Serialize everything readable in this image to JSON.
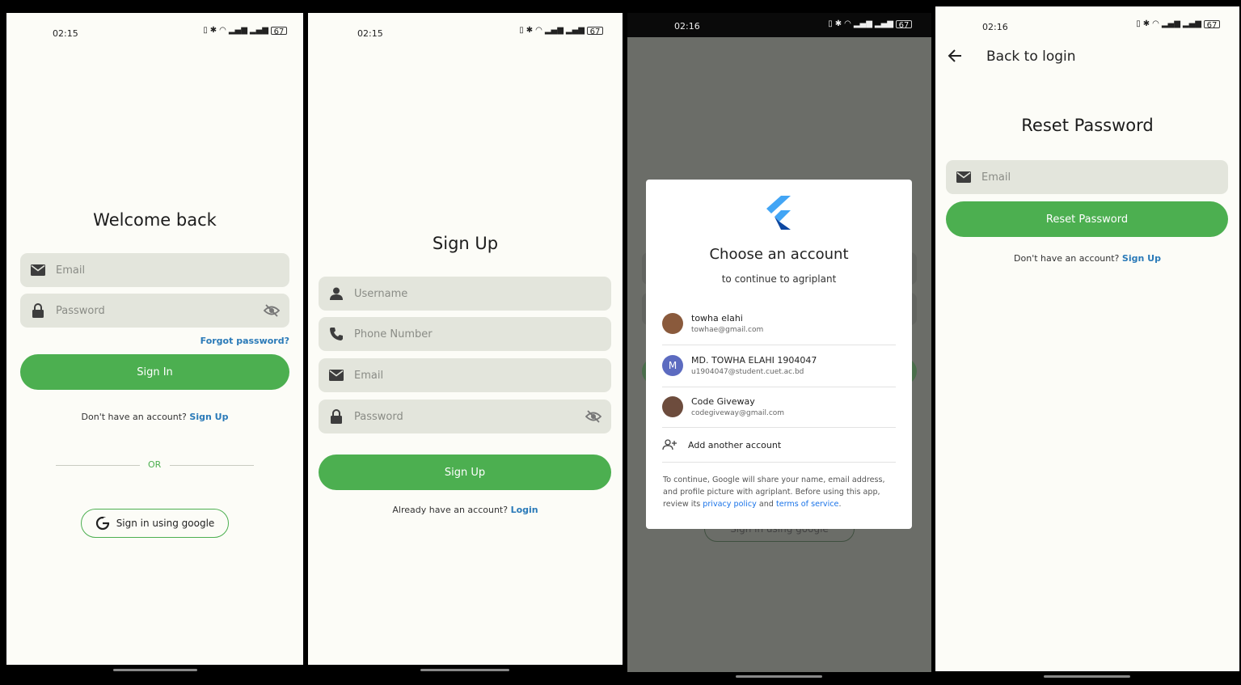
{
  "screens": {
    "login": {
      "time": "02:15",
      "battery": "67",
      "title": "Welcome back",
      "email_placeholder": "Email",
      "password_placeholder": "Password",
      "forgot": "Forgot password?",
      "signin_button": "Sign In",
      "no_account": "Don't have an account?",
      "signup_link": "Sign Up",
      "or": "OR",
      "google_button": "Sign in using google"
    },
    "signup": {
      "time": "02:15",
      "battery": "67",
      "title": "Sign Up",
      "username_placeholder": "Username",
      "phone_placeholder": "Phone Number",
      "email_placeholder": "Email",
      "password_placeholder": "Password",
      "signup_button": "Sign Up",
      "have_account": "Already have an account?",
      "login_link": "Login"
    },
    "chooser": {
      "time": "02:16",
      "battery": "67",
      "title": "Choose an account",
      "subtitle": "to continue to agriplant",
      "accounts": [
        {
          "name": "towha elahi",
          "email": "towhae@gmail.com"
        },
        {
          "name": "MD. TOWHA ELAHI 1904047",
          "email": "u1904047@student.cuet.ac.bd",
          "initial": "M"
        },
        {
          "name": "Code Giveway",
          "email": "codegiveway@gmail.com"
        }
      ],
      "add_account": "Add another account",
      "disclaimer_1": "To continue, Google will share your name, email address,",
      "disclaimer_2": "and profile picture with agriplant. Before using this app,",
      "disclaimer_3a": "review its ",
      "privacy": "privacy policy",
      "and": " and ",
      "terms": "terms of service",
      "period": ".",
      "bg_google": "Sign in using google"
    },
    "reset": {
      "time": "02:16",
      "battery": "67",
      "back_label": "Back to login",
      "title": "Reset Password",
      "email_placeholder": "Email",
      "reset_button": "Reset Password",
      "no_account": "Don't have an account?",
      "signup_link": "Sign Up"
    }
  },
  "colors": {
    "accent": "#4caf50",
    "link": "#2a7ab8",
    "field_bg": "#e3e5dc",
    "page_bg": "#fcfcf7"
  }
}
